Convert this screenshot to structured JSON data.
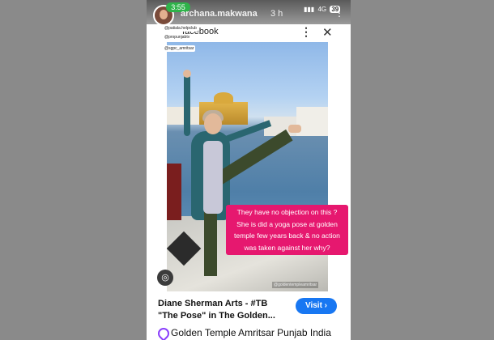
{
  "story": {
    "time": "3:55",
    "username": "archana.makwana",
    "age": "3 h",
    "network": "4G",
    "battery": "39"
  },
  "embed": {
    "title": "facebook"
  },
  "mentions": [
    "@patiala.helpclub",
    "@propunjabtv",
    "@sgpc_amritsar"
  ],
  "photo": {
    "tag": "@goldentempleamritsar"
  },
  "caption": {
    "line1": "They have no objection on this ?",
    "line2": "She is did a yoga pose at golden",
    "line3": "temple few years back & no action",
    "line4": "was taken against her why?"
  },
  "ad": {
    "title_line1": "Diane Sherman Arts - #TB",
    "title_line2": "\"The Pose\" in The Golden...",
    "button": "Visit ›"
  },
  "location": {
    "text": "Golden Temple Amritsar Punjab India"
  },
  "colors": {
    "caption_bg": "#e6186f",
    "visit_bg": "#1877f2",
    "time_pill": "#2fb34a"
  },
  "icons": [
    "more-vertical-icon",
    "close-icon",
    "zoom-icon",
    "location-pin-icon"
  ]
}
